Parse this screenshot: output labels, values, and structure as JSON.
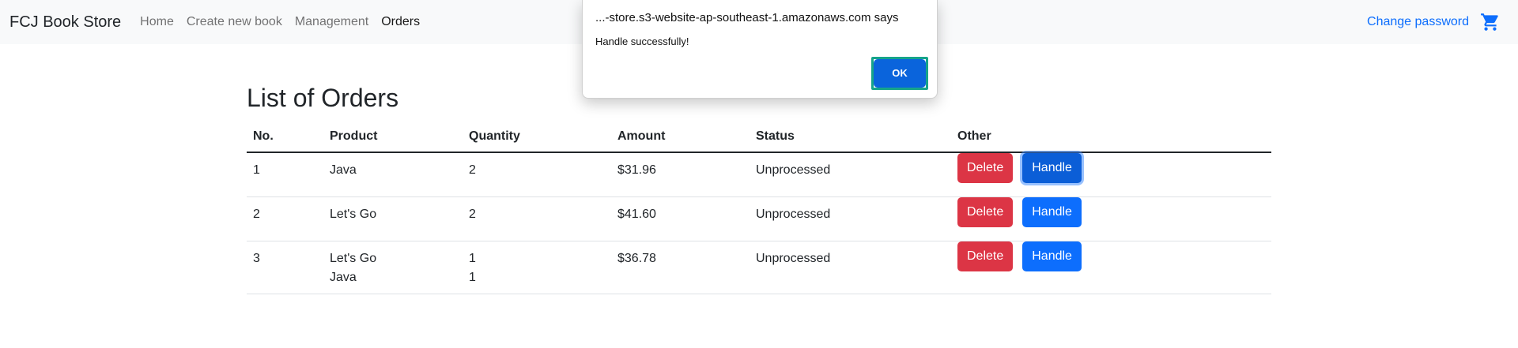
{
  "navbar": {
    "brand": "FCJ Book Store",
    "links": [
      "Home",
      "Create new book",
      "Management",
      "Orders"
    ],
    "active_link": "Orders",
    "change_password": "Change password",
    "cart_icon": "shopping-cart-icon"
  },
  "page": {
    "title": "List of Orders",
    "headers": [
      "No.",
      "Product",
      "Quantity",
      "Amount",
      "Status",
      "Other"
    ],
    "rows": [
      {
        "no": "1",
        "products": [
          "Java"
        ],
        "quantities": [
          "2"
        ],
        "amount": "$31.96",
        "status": "Unprocessed",
        "delete": "Delete",
        "handle": "Handle"
      },
      {
        "no": "2",
        "products": [
          "Let's Go"
        ],
        "quantities": [
          "2"
        ],
        "amount": "$41.60",
        "status": "Unprocessed",
        "delete": "Delete",
        "handle": "Handle"
      },
      {
        "no": "3",
        "products": [
          "Let's Go",
          "Java"
        ],
        "quantities": [
          "1",
          "1"
        ],
        "amount": "$36.78",
        "status": "Unprocessed",
        "delete": "Delete",
        "handle": "Handle"
      }
    ]
  },
  "dialog": {
    "title": "...-store.s3-website-ap-southeast-1.amazonaws.com says",
    "message": "Handle successfully!",
    "ok_label": "OK"
  },
  "colors": {
    "primary": "#0d6efd",
    "danger": "#dc3545",
    "focus_ring": "#16a48a"
  }
}
